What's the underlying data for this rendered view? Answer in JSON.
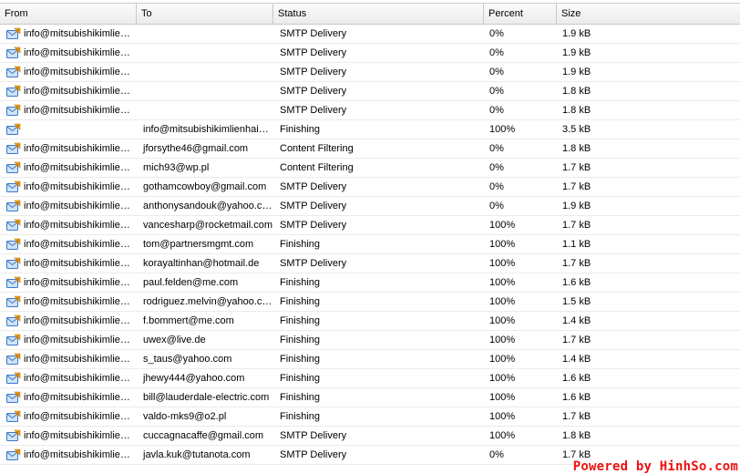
{
  "columns": {
    "from": "From",
    "to": "To",
    "status": "Status",
    "percent": "Percent",
    "size": "Size"
  },
  "icon": "mail-envelope-icon",
  "rows": [
    {
      "from": "info@mitsubishikimlienhaiphong.com",
      "to": "",
      "status": "SMTP Delivery",
      "percent": "0%",
      "size": "1.9 kB"
    },
    {
      "from": "info@mitsubishikimlienhaiphong.com",
      "to": "",
      "status": "SMTP Delivery",
      "percent": "0%",
      "size": "1.9 kB"
    },
    {
      "from": "info@mitsubishikimlienhaiphong.com",
      "to": "",
      "status": "SMTP Delivery",
      "percent": "0%",
      "size": "1.9 kB"
    },
    {
      "from": "info@mitsubishikimlienhaiphong.com",
      "to": "",
      "status": "SMTP Delivery",
      "percent": "0%",
      "size": "1.8 kB"
    },
    {
      "from": "info@mitsubishikimlienhaiphong.com",
      "to": "",
      "status": "SMTP Delivery",
      "percent": "0%",
      "size": "1.8 kB"
    },
    {
      "from": "",
      "to": "info@mitsubishikimlienhaiphong.com",
      "status": "Finishing",
      "percent": "100%",
      "size": "3.5 kB"
    },
    {
      "from": "info@mitsubishikimlienhaiphong.com",
      "to": "jforsythe46@gmail.com",
      "status": "Content Filtering",
      "percent": "0%",
      "size": "1.8 kB"
    },
    {
      "from": "info@mitsubishikimlienhaiphong.com",
      "to": "mich93@wp.pl",
      "status": "Content Filtering",
      "percent": "0%",
      "size": "1.7 kB"
    },
    {
      "from": "info@mitsubishikimlienhaiphong.com",
      "to": "gothamcowboy@gmail.com",
      "status": "SMTP Delivery",
      "percent": "0%",
      "size": "1.7 kB"
    },
    {
      "from": "info@mitsubishikimlienhaiphong.com",
      "to": "anthonysandouk@yahoo.com",
      "status": "SMTP Delivery",
      "percent": "0%",
      "size": "1.9 kB"
    },
    {
      "from": "info@mitsubishikimlienhaiphong.com",
      "to": "vancesharp@rocketmail.com",
      "status": "SMTP Delivery",
      "percent": "100%",
      "size": "1.7 kB"
    },
    {
      "from": "info@mitsubishikimlienhaiphong.com",
      "to": "tom@partnersmgmt.com",
      "status": "Finishing",
      "percent": "100%",
      "size": "1.1 kB"
    },
    {
      "from": "info@mitsubishikimlienhaiphong.com",
      "to": "korayaltinhan@hotmail.de",
      "status": "SMTP Delivery",
      "percent": "100%",
      "size": "1.7 kB"
    },
    {
      "from": "info@mitsubishikimlienhaiphong.com",
      "to": "paul.felden@me.com",
      "status": "Finishing",
      "percent": "100%",
      "size": "1.6 kB"
    },
    {
      "from": "info@mitsubishikimlienhaiphong.com",
      "to": "rodriguez.melvin@yahoo.com",
      "status": "Finishing",
      "percent": "100%",
      "size": "1.5 kB"
    },
    {
      "from": "info@mitsubishikimlienhaiphong.com",
      "to": "f.bommert@me.com",
      "status": "Finishing",
      "percent": "100%",
      "size": "1.4 kB"
    },
    {
      "from": "info@mitsubishikimlienhaiphong.com",
      "to": "uwex@live.de",
      "status": "Finishing",
      "percent": "100%",
      "size": "1.7 kB"
    },
    {
      "from": "info@mitsubishikimlienhaiphong.com",
      "to": "s_taus@yahoo.com",
      "status": "Finishing",
      "percent": "100%",
      "size": "1.4 kB"
    },
    {
      "from": "info@mitsubishikimlienhaiphong.com",
      "to": "jhewy444@yahoo.com",
      "status": "Finishing",
      "percent": "100%",
      "size": "1.6 kB"
    },
    {
      "from": "info@mitsubishikimlienhaiphong.com",
      "to": "bill@lauderdale-electric.com",
      "status": "Finishing",
      "percent": "100%",
      "size": "1.6 kB"
    },
    {
      "from": "info@mitsubishikimlienhaiphong.com",
      "to": "valdo-mks9@o2.pl",
      "status": "Finishing",
      "percent": "100%",
      "size": "1.7 kB"
    },
    {
      "from": "info@mitsubishikimlienhaiphong.com",
      "to": "cuccagnacaffe@gmail.com",
      "status": "SMTP Delivery",
      "percent": "100%",
      "size": "1.8 kB"
    },
    {
      "from": "info@mitsubishikimlienhaiphong.com",
      "to": "javla.kuk@tutanota.com",
      "status": "SMTP Delivery",
      "percent": "0%",
      "size": "1.7 kB"
    }
  ],
  "watermark": "Powered by HinhSo.com"
}
